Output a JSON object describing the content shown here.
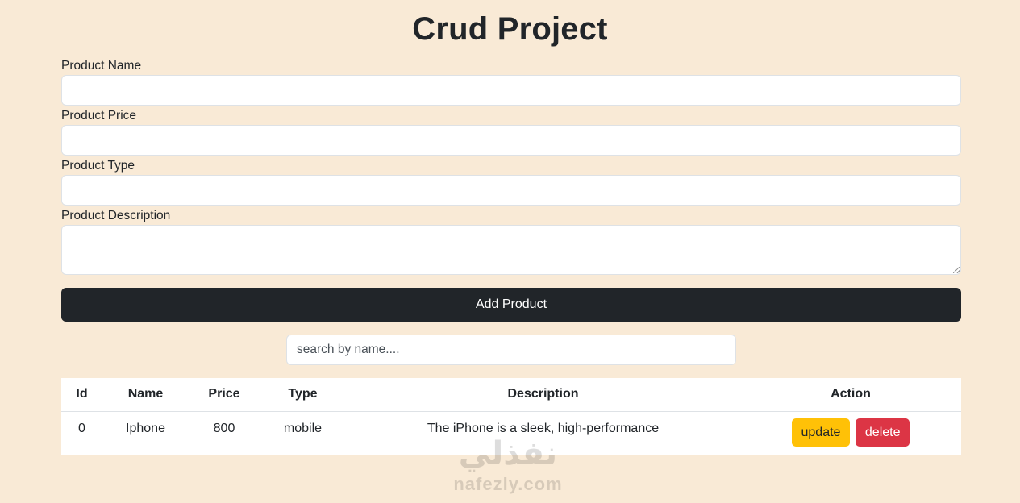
{
  "page": {
    "title": "Crud Project"
  },
  "form": {
    "name_label": "Product Name",
    "name_value": "",
    "price_label": "Product Price",
    "price_value": "",
    "type_label": "Product Type",
    "type_value": "",
    "description_label": "Product Description",
    "description_value": "",
    "submit_label": "Add Product"
  },
  "search": {
    "placeholder": "search by name...."
  },
  "table": {
    "headers": [
      "Id",
      "Name",
      "Price",
      "Type",
      "Description",
      "Action"
    ],
    "rows": [
      {
        "id": "0",
        "name": "Iphone",
        "price": "800",
        "type": "mobile",
        "description": "The iPhone is a sleek, high-performance",
        "update_label": "update",
        "delete_label": "delete"
      }
    ]
  },
  "watermark": {
    "arabic": "نفذلي",
    "latin": "nafezly.com"
  },
  "colors": {
    "background": "#f9ead6",
    "primary_dark": "#212529",
    "warning": "#ffc107",
    "danger": "#dc3545"
  }
}
